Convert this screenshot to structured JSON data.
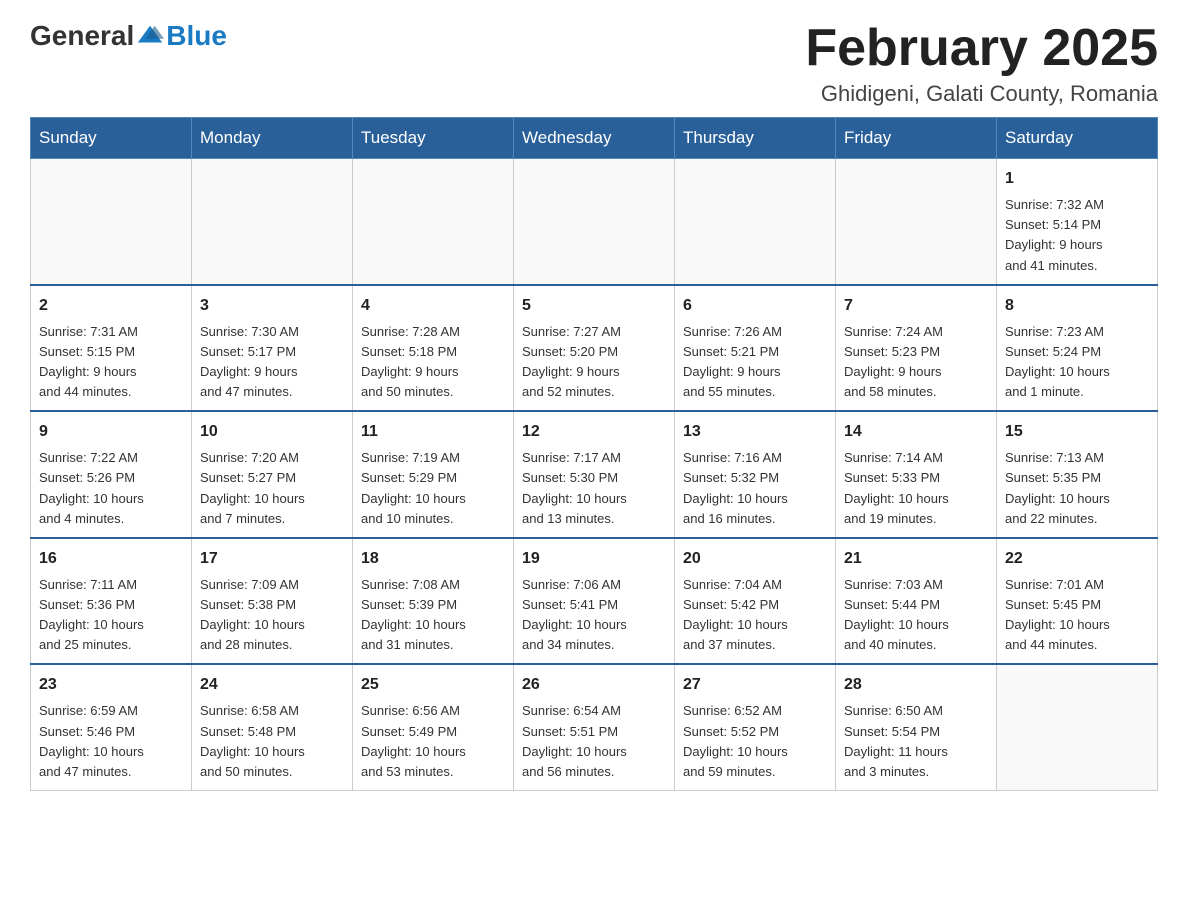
{
  "logo": {
    "text_general": "General",
    "text_blue": "Blue"
  },
  "title": "February 2025",
  "location": "Ghidigeni, Galati County, Romania",
  "weekdays": [
    "Sunday",
    "Monday",
    "Tuesday",
    "Wednesday",
    "Thursday",
    "Friday",
    "Saturday"
  ],
  "weeks": [
    [
      {
        "day": "",
        "info": ""
      },
      {
        "day": "",
        "info": ""
      },
      {
        "day": "",
        "info": ""
      },
      {
        "day": "",
        "info": ""
      },
      {
        "day": "",
        "info": ""
      },
      {
        "day": "",
        "info": ""
      },
      {
        "day": "1",
        "info": "Sunrise: 7:32 AM\nSunset: 5:14 PM\nDaylight: 9 hours\nand 41 minutes."
      }
    ],
    [
      {
        "day": "2",
        "info": "Sunrise: 7:31 AM\nSunset: 5:15 PM\nDaylight: 9 hours\nand 44 minutes."
      },
      {
        "day": "3",
        "info": "Sunrise: 7:30 AM\nSunset: 5:17 PM\nDaylight: 9 hours\nand 47 minutes."
      },
      {
        "day": "4",
        "info": "Sunrise: 7:28 AM\nSunset: 5:18 PM\nDaylight: 9 hours\nand 50 minutes."
      },
      {
        "day": "5",
        "info": "Sunrise: 7:27 AM\nSunset: 5:20 PM\nDaylight: 9 hours\nand 52 minutes."
      },
      {
        "day": "6",
        "info": "Sunrise: 7:26 AM\nSunset: 5:21 PM\nDaylight: 9 hours\nand 55 minutes."
      },
      {
        "day": "7",
        "info": "Sunrise: 7:24 AM\nSunset: 5:23 PM\nDaylight: 9 hours\nand 58 minutes."
      },
      {
        "day": "8",
        "info": "Sunrise: 7:23 AM\nSunset: 5:24 PM\nDaylight: 10 hours\nand 1 minute."
      }
    ],
    [
      {
        "day": "9",
        "info": "Sunrise: 7:22 AM\nSunset: 5:26 PM\nDaylight: 10 hours\nand 4 minutes."
      },
      {
        "day": "10",
        "info": "Sunrise: 7:20 AM\nSunset: 5:27 PM\nDaylight: 10 hours\nand 7 minutes."
      },
      {
        "day": "11",
        "info": "Sunrise: 7:19 AM\nSunset: 5:29 PM\nDaylight: 10 hours\nand 10 minutes."
      },
      {
        "day": "12",
        "info": "Sunrise: 7:17 AM\nSunset: 5:30 PM\nDaylight: 10 hours\nand 13 minutes."
      },
      {
        "day": "13",
        "info": "Sunrise: 7:16 AM\nSunset: 5:32 PM\nDaylight: 10 hours\nand 16 minutes."
      },
      {
        "day": "14",
        "info": "Sunrise: 7:14 AM\nSunset: 5:33 PM\nDaylight: 10 hours\nand 19 minutes."
      },
      {
        "day": "15",
        "info": "Sunrise: 7:13 AM\nSunset: 5:35 PM\nDaylight: 10 hours\nand 22 minutes."
      }
    ],
    [
      {
        "day": "16",
        "info": "Sunrise: 7:11 AM\nSunset: 5:36 PM\nDaylight: 10 hours\nand 25 minutes."
      },
      {
        "day": "17",
        "info": "Sunrise: 7:09 AM\nSunset: 5:38 PM\nDaylight: 10 hours\nand 28 minutes."
      },
      {
        "day": "18",
        "info": "Sunrise: 7:08 AM\nSunset: 5:39 PM\nDaylight: 10 hours\nand 31 minutes."
      },
      {
        "day": "19",
        "info": "Sunrise: 7:06 AM\nSunset: 5:41 PM\nDaylight: 10 hours\nand 34 minutes."
      },
      {
        "day": "20",
        "info": "Sunrise: 7:04 AM\nSunset: 5:42 PM\nDaylight: 10 hours\nand 37 minutes."
      },
      {
        "day": "21",
        "info": "Sunrise: 7:03 AM\nSunset: 5:44 PM\nDaylight: 10 hours\nand 40 minutes."
      },
      {
        "day": "22",
        "info": "Sunrise: 7:01 AM\nSunset: 5:45 PM\nDaylight: 10 hours\nand 44 minutes."
      }
    ],
    [
      {
        "day": "23",
        "info": "Sunrise: 6:59 AM\nSunset: 5:46 PM\nDaylight: 10 hours\nand 47 minutes."
      },
      {
        "day": "24",
        "info": "Sunrise: 6:58 AM\nSunset: 5:48 PM\nDaylight: 10 hours\nand 50 minutes."
      },
      {
        "day": "25",
        "info": "Sunrise: 6:56 AM\nSunset: 5:49 PM\nDaylight: 10 hours\nand 53 minutes."
      },
      {
        "day": "26",
        "info": "Sunrise: 6:54 AM\nSunset: 5:51 PM\nDaylight: 10 hours\nand 56 minutes."
      },
      {
        "day": "27",
        "info": "Sunrise: 6:52 AM\nSunset: 5:52 PM\nDaylight: 10 hours\nand 59 minutes."
      },
      {
        "day": "28",
        "info": "Sunrise: 6:50 AM\nSunset: 5:54 PM\nDaylight: 11 hours\nand 3 minutes."
      },
      {
        "day": "",
        "info": ""
      }
    ]
  ]
}
